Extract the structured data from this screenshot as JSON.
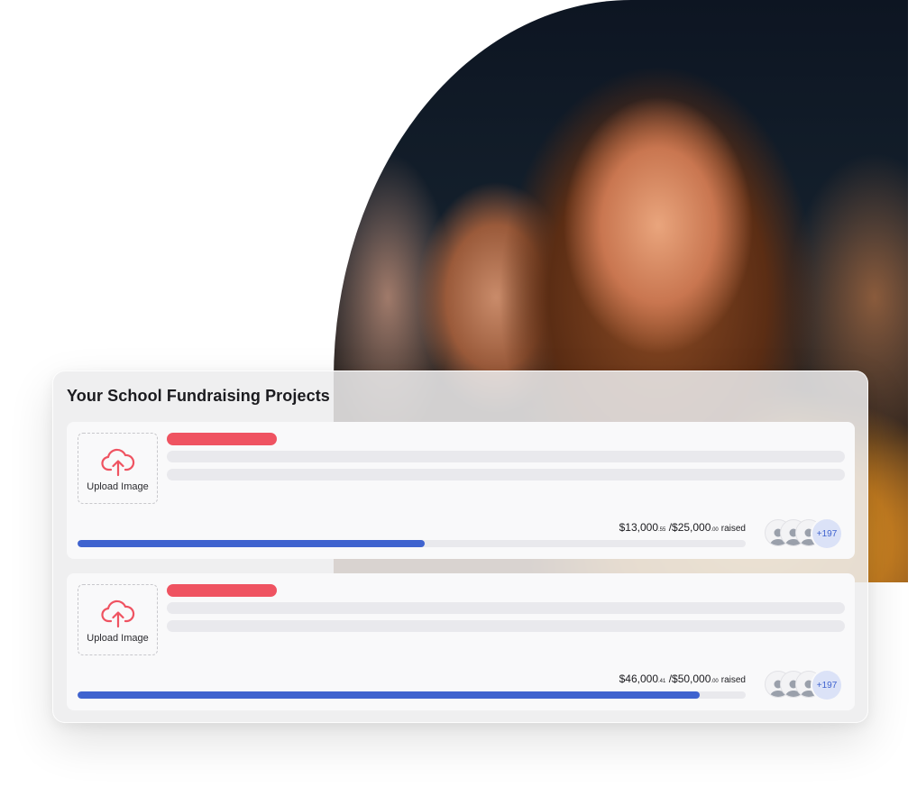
{
  "photo": {
    "alt_name": "hero-photo"
  },
  "card": {
    "title": "Your School Fundraising Projects",
    "projects": [
      {
        "upload_label": "Upload Image",
        "raised_main": "$13,000",
        "raised_cents": ".55",
        "goal_main": "/$25,000",
        "goal_cents": ".00",
        "raised_word": "raised",
        "progress_fraction": 0.52,
        "supporters_more": "+197"
      },
      {
        "upload_label": "Upload Image",
        "raised_main": "$46,000",
        "raised_cents": ".41",
        "goal_main": "/$50,000",
        "goal_cents": ".00",
        "raised_word": "raised",
        "progress_fraction": 0.931,
        "supporters_more": "+197"
      }
    ]
  },
  "colors": {
    "accent_red": "#ef5361",
    "progress_blue": "#3f63cf",
    "skeleton_gray": "#e9e9ed"
  },
  "icons": [
    "cloud-upload-icon",
    "user-avatar-icon"
  ]
}
